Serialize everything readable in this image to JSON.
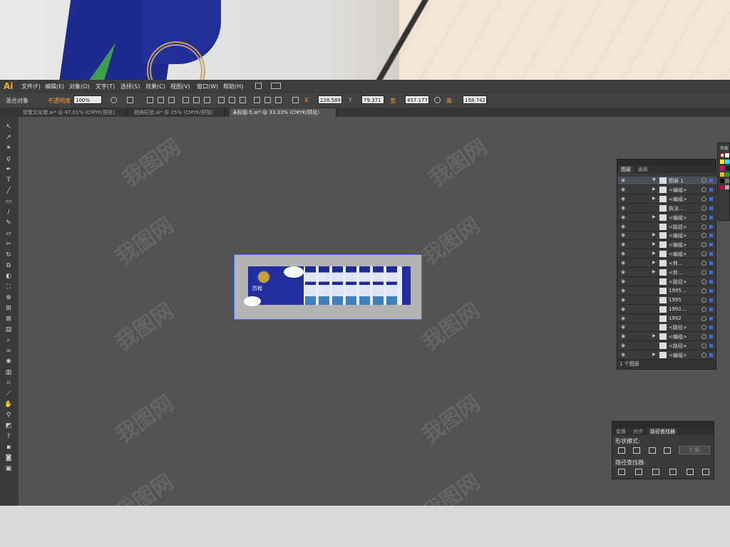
{
  "app": {
    "logo": "Ai"
  },
  "menu": [
    "文件(F)",
    "编辑(E)",
    "对象(O)",
    "文字(T)",
    "选择(S)",
    "效果(C)",
    "视图(V)",
    "窗口(W)",
    "帮助(H)"
  ],
  "control_bar": {
    "mode_label": "混合对象",
    "opacity_label": "不透明度",
    "opacity_value": "100%",
    "x_label": "X",
    "x_value": "228.589",
    "y_label": "Y",
    "y_value": "79.371",
    "w_label": "宽",
    "w_value": "457.177",
    "h_label": "高",
    "h_value": "158.742"
  },
  "tabs": [
    {
      "label": "管警文化墙.ai* @ 47.01% (CMYK/预览)",
      "active": false
    },
    {
      "label": "税纳征验.ai* @ 25% (CMYK/预览)",
      "active": false
    },
    {
      "label": "未标题-5.ai* @ 33.33% (CMYK/预览)",
      "active": true
    }
  ],
  "artboard": {
    "caption": "历程"
  },
  "layers_panel": {
    "tabs": [
      "图层",
      "画板"
    ],
    "rows": [
      {
        "name": "图层 1",
        "arrow": "▼",
        "top": true
      },
      {
        "name": "<编组>",
        "arrow": "▶"
      },
      {
        "name": "<编组>",
        "arrow": "▶"
      },
      {
        "name": "执法...",
        "arrow": ""
      },
      {
        "name": "<编组>",
        "arrow": "▶"
      },
      {
        "name": "<路径>",
        "arrow": ""
      },
      {
        "name": "<编组>",
        "arrow": "▶"
      },
      {
        "name": "<编组>",
        "arrow": "▶"
      },
      {
        "name": "<编组>",
        "arrow": "▶"
      },
      {
        "name": "<剪...",
        "arrow": "▶"
      },
      {
        "name": "<剪...",
        "arrow": "▶"
      },
      {
        "name": "<路径>",
        "arrow": ""
      },
      {
        "name": "1995...",
        "arrow": ""
      },
      {
        "name": "1995",
        "arrow": ""
      },
      {
        "name": "1992...",
        "arrow": ""
      },
      {
        "name": "1992",
        "arrow": ""
      },
      {
        "name": "<路径>",
        "arrow": ""
      },
      {
        "name": "<编组>",
        "arrow": "▶"
      },
      {
        "name": "<路径>",
        "arrow": ""
      },
      {
        "name": "<编组>",
        "arrow": "▶"
      }
    ],
    "footer": "1 个图层"
  },
  "pathfinder_panel": {
    "tabs": [
      "变换",
      "对齐",
      "路径查找器"
    ],
    "shape_modes_label": "形状模式:",
    "expand_label": "扩展",
    "pathfinders_label": "路径查找器:"
  },
  "swatch_panel": {
    "label": "色板"
  },
  "watermark": "我图网",
  "colors": {
    "accent": "#f6a623",
    "selection": "#3a67ff",
    "canvas": "#535353"
  }
}
